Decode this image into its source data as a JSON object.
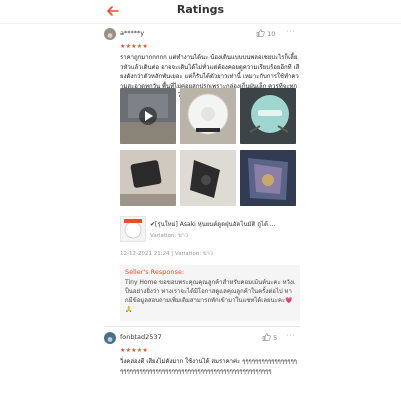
{
  "header": {
    "title": "Ratings",
    "back_icon": "arrow-left-icon",
    "accent": "#ee4d2d"
  },
  "reviews": [
    {
      "username": "a*****y",
      "stars": "★★★★★",
      "likes": "10",
      "more": "···",
      "text": "ราคาถูกมากกกกก แต่ทำงานได้นะ น้องเดินแบบบนพลอเชยบะไรก็เลี้ยวหัวแล้วเดินต่อ อาจจะเดินได้ไม่ทั่วแต่ต้องคอยดูความเรียบร้อยอีกที เสียงดังกว่าตัวหลักพันเยอะ แต่ก็รับได้ตัวยาวเท่านี้ เหมาะกับการใช้ทำความสะอาดทุกวัน พื้นที่ไม่ค่อยสกปรกเพราะกล่องเก็บฝุ่นเล็ก ควรที่จะทุกครั้งหลังทำงาน ลูมแค่ 7 ซม. ดีเลย",
      "product_name": "✔[รุ่นใหม่] Asaki หุ่นยนต์ดูดฝุ่นอัตโนมัติ ถูได้ ...",
      "variation": "Variation: ขาว",
      "date": "12-12-2021 21:24 | Variation: ขาว",
      "seller_label": "Seller's Response:",
      "seller_text": "Tiny Home ขอขอบพระคุณคุณลูกค้าสำหรับคอมเม้นต์นะคะ หวังเป็นอย่างยิ่งว่า ทางเราจะได้มีโอกาสดูแลคุณลูกค้าในครั้งต่อไป หากมีข้อมูลสอบถามเพิ่มเติมสามารถทักเข้ามาในแชทได้เลยนะคะ💗🙏"
    },
    {
      "username": "fonbtad2537",
      "stars": "★★★★★",
      "likes": "5",
      "more": "···",
      "text": "วิ่งคล่องดี เสียงไม่ดังมาก ใช้งานได้ สมราคาค่ะ ๆๆๆๆๆๆๆๆๆๆๆๆๆๆๆๆๆๆๆๆๆๆๆๆๆๆๆๆๆๆๆๆๆๆๆๆๆๆๆๆๆๆๆๆๆๆๆๆๆๆๆๆๆๆๆๆๆๆๆๆๆๆๆๆ"
    }
  ]
}
